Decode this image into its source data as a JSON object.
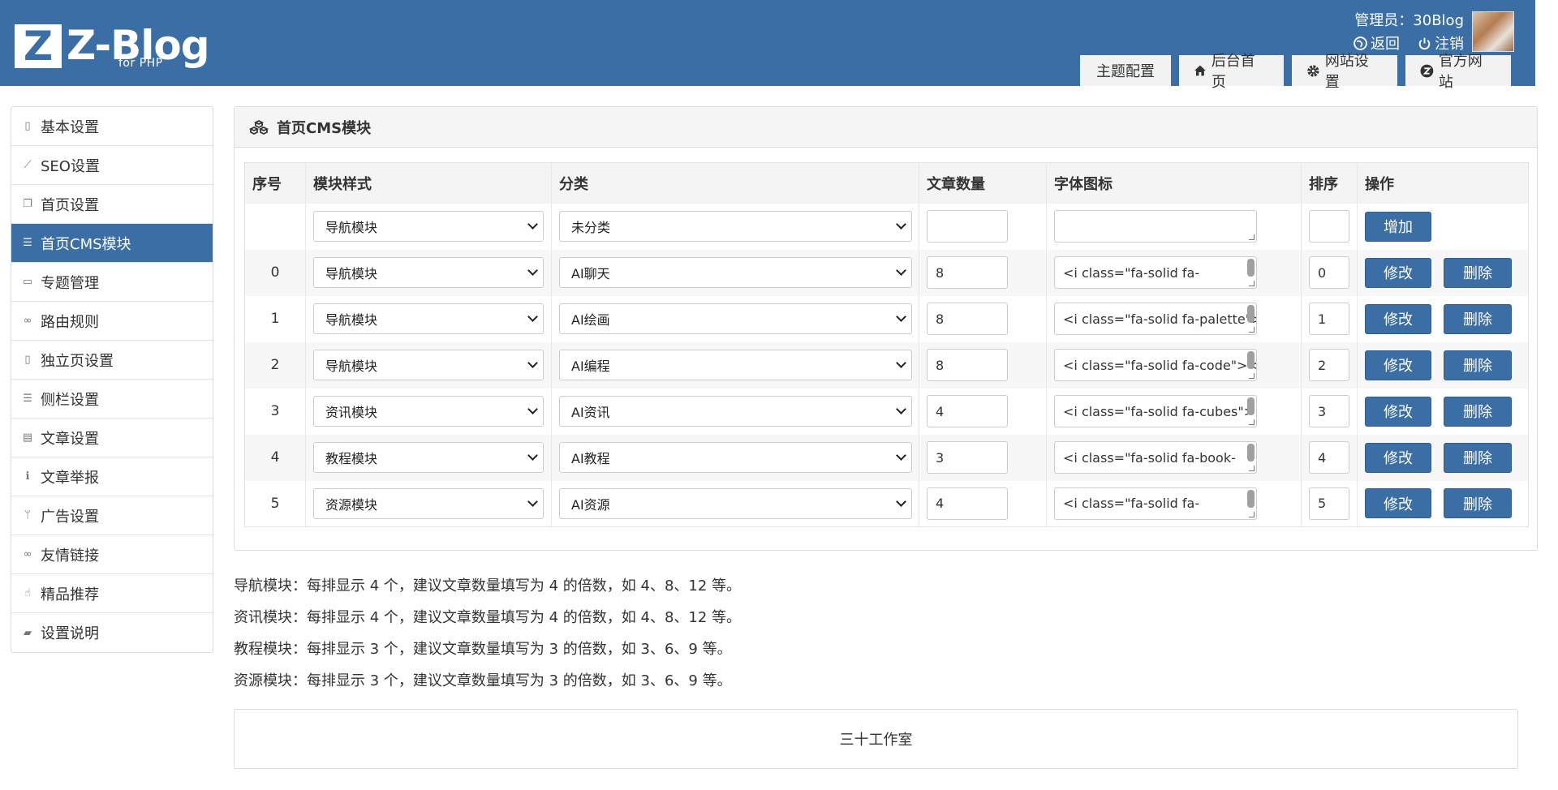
{
  "header": {
    "logo_letter": "Z",
    "logo_main": "Z-Blog",
    "logo_sub": "for PHP",
    "user_line": "管理员：30Blog",
    "back_label": "返回",
    "logout_label": "注销",
    "tabs": [
      "主题配置",
      "后台首页",
      "网站设置",
      "官方网站"
    ]
  },
  "sidebar": {
    "items": [
      {
        "label": "基本设置",
        "icon": "page-icon"
      },
      {
        "label": "SEO设置",
        "icon": "chart-line-icon"
      },
      {
        "label": "首页设置",
        "icon": "copy-icon"
      },
      {
        "label": "首页CMS模块",
        "icon": "list-icon"
      },
      {
        "label": "专题管理",
        "icon": "window-icon"
      },
      {
        "label": "路由规则",
        "icon": "link-icon"
      },
      {
        "label": "独立页设置",
        "icon": "file-icon"
      },
      {
        "label": "侧栏设置",
        "icon": "list-icon"
      },
      {
        "label": "文章设置",
        "icon": "newspaper-icon"
      },
      {
        "label": "文章举报",
        "icon": "info-icon"
      },
      {
        "label": "广告设置",
        "icon": "fork-icon"
      },
      {
        "label": "友情链接",
        "icon": "link-icon"
      },
      {
        "label": "精品推荐",
        "icon": "thumbs-up-icon"
      },
      {
        "label": "设置说明",
        "icon": "book-icon"
      }
    ]
  },
  "panel": {
    "title": "首页CMS模块",
    "columns": [
      "序号",
      "模块样式",
      "分类",
      "文章数量",
      "字体图标",
      "排序",
      "操作"
    ],
    "new_row": {
      "style": "导航模块",
      "category": "未分类",
      "count": "",
      "icon": "",
      "order": "",
      "add_label": "增加"
    },
    "rows": [
      {
        "idx": "0",
        "style": "导航模块",
        "category": "AI聊天",
        "count": "8",
        "icon": "<i class=\"fa-solid fa-",
        "order": "0"
      },
      {
        "idx": "1",
        "style": "导航模块",
        "category": "AI绘画",
        "count": "8",
        "icon": "<i class=\"fa-solid fa-palette\">",
        "order": "1"
      },
      {
        "idx": "2",
        "style": "导航模块",
        "category": "AI编程",
        "count": "8",
        "icon": "<i class=\"fa-solid fa-code\"></i>",
        "order": "2"
      },
      {
        "idx": "3",
        "style": "资讯模块",
        "category": "AI资讯",
        "count": "4",
        "icon": "<i class=\"fa-solid fa-cubes\">",
        "order": "3"
      },
      {
        "idx": "4",
        "style": "教程模块",
        "category": "AI教程",
        "count": "3",
        "icon": "<i class=\"fa-solid fa-book-",
        "order": "4"
      },
      {
        "idx": "5",
        "style": "资源模块",
        "category": "AI资源",
        "count": "4",
        "icon": "<i class=\"fa-solid fa-",
        "order": "5"
      }
    ],
    "edit_label": "修改",
    "delete_label": "删除"
  },
  "notes": [
    "导航模块：每排显示 4 个，建议文章数量填写为 4 的倍数，如 4、8、12 等。",
    "资讯模块：每排显示 4 个，建议文章数量填写为 4 的倍数，如 4、8、12 等。",
    "教程模块：每排显示 3 个，建议文章数量填写为 3 的倍数，如 3、6、9 等。",
    "资源模块：每排显示 3 个，建议文章数量填写为 3 的倍数，如 3、6、9 等。"
  ],
  "footer": {
    "text": "三十工作室"
  },
  "colors": {
    "brand": "#3a6ea5",
    "tab_bg": "#f2f2f2"
  }
}
